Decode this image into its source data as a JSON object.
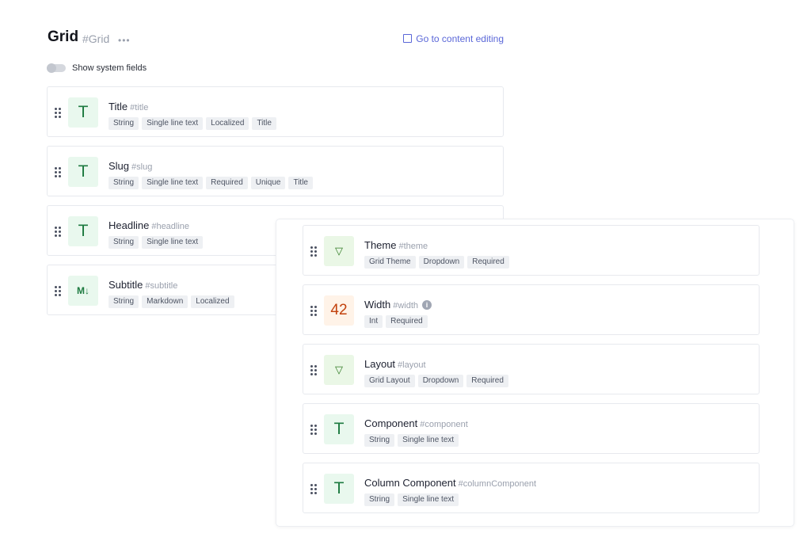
{
  "header": {
    "title": "Grid",
    "api_id": "#Grid",
    "more_glyph": "•••",
    "content_link": "Go to content editing"
  },
  "toggle": {
    "label": "Show system fields",
    "on": false
  },
  "fields": [
    {
      "name": "Title",
      "api_id": "#title",
      "icon": "text-type-icon",
      "glyph": "T",
      "tags": [
        "String",
        "Single line text",
        "Localized",
        "Title"
      ]
    },
    {
      "name": "Slug",
      "api_id": "#slug",
      "icon": "text-type-icon",
      "glyph": "T",
      "tags": [
        "String",
        "Single line text",
        "Required",
        "Unique",
        "Title"
      ]
    },
    {
      "name": "Headline",
      "api_id": "#headline",
      "icon": "text-type-icon",
      "glyph": "T",
      "tags": [
        "String",
        "Single line text"
      ]
    },
    {
      "name": "Subtitle",
      "api_id": "#subtitle",
      "icon": "markdown-type-icon",
      "glyph": "M↓",
      "tags": [
        "String",
        "Markdown",
        "Localized"
      ]
    }
  ],
  "component_fields": [
    {
      "name": "Theme",
      "api_id": "#theme",
      "icon": "dropdown-type-icon",
      "glyph": "▽",
      "tags": [
        "Grid Theme",
        "Dropdown",
        "Required"
      ]
    },
    {
      "name": "Width",
      "api_id": "#width",
      "icon": "number-type-icon",
      "glyph": "42",
      "info": "i",
      "tags": [
        "Int",
        "Required"
      ]
    },
    {
      "name": "Layout",
      "api_id": "#layout",
      "icon": "dropdown-type-icon",
      "glyph": "▽",
      "tags": [
        "Grid Layout",
        "Dropdown",
        "Required"
      ]
    },
    {
      "name": "Component",
      "api_id": "#component",
      "icon": "text-type-icon",
      "glyph": "T",
      "tags": [
        "String",
        "Single line text"
      ]
    },
    {
      "name": "Column Component",
      "api_id": "#columnComponent",
      "icon": "text-type-icon",
      "glyph": "T",
      "tags": [
        "String",
        "Single line text"
      ]
    }
  ],
  "colors": {
    "link": "#5a67d8",
    "text_icon_bg": "#e9f8ee",
    "number_icon_bg": "#fff3e8",
    "tag_bg": "#eef0f3"
  }
}
